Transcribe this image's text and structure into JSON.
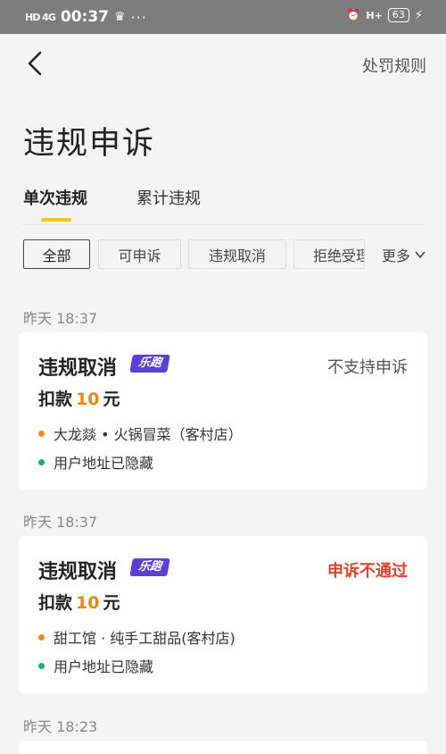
{
  "status_bar": {
    "signal": "HD 4G",
    "time": "00:37",
    "dots": "···",
    "network": "H+",
    "battery": "63"
  },
  "nav": {
    "rules_link": "处罚规则"
  },
  "page_title": "违规申诉",
  "tabs": [
    {
      "label": "单次违规",
      "active": true
    },
    {
      "label": "累计违规",
      "active": false
    }
  ],
  "filters": {
    "chips": [
      "全部",
      "可申诉",
      "违规取消",
      "拒绝受理"
    ],
    "more": "更多"
  },
  "records": [
    {
      "date": "昨天 18:37",
      "title": "违规取消",
      "badge": "乐跑",
      "status": "不支持申诉",
      "deduct_prefix": "扣款",
      "amount": "10",
      "unit": "元",
      "store": "大龙燚 • 火锅冒菜（客村店）",
      "address": "用户地址已隐藏"
    },
    {
      "date": "昨天 18:37",
      "title": "违规取消",
      "badge": "乐跑",
      "status": "申诉不通过",
      "deduct_prefix": "扣款",
      "amount": "10",
      "unit": "元",
      "store": "甜工馆 · 纯手工甜品(客村店)",
      "address": "用户地址已隐藏"
    },
    {
      "date": "昨天 18:23"
    }
  ],
  "colors": {
    "accent_yellow": "#f7c41a",
    "amount_orange": "#f0870a",
    "reject_red": "#e0422b",
    "badge_purple": "#5b3fd9",
    "store_dot": "#f08a1c",
    "address_dot": "#15b36b"
  }
}
